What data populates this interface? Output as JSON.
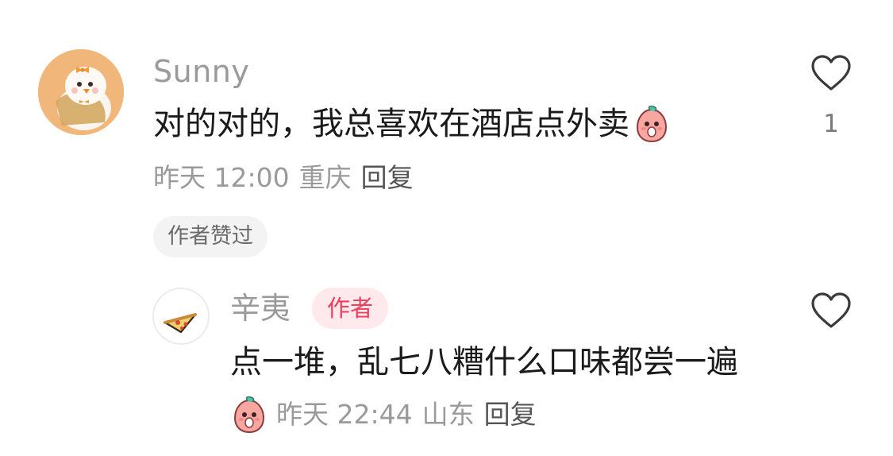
{
  "comment": {
    "username": "Sunny",
    "text": "对的对的，我总喜欢在酒店点外卖",
    "emoji_icon": "peach-emoji",
    "time": "昨天 12:00",
    "location": "重庆",
    "reply_label": "回复",
    "author_liked_chip": "作者赞过",
    "like_count": "1"
  },
  "reply": {
    "username": "辛夷",
    "author_badge": "作者",
    "text": "点一堆，乱七八糟什么口味都尝一遍",
    "emoji_icon": "peach-emoji",
    "time": "昨天 22:44",
    "location": "山东",
    "reply_label": "回复"
  },
  "colors": {
    "accent_badge_text": "#f23d5a",
    "accent_badge_bg": "#ffe9ec",
    "muted_text": "#9a9a9a",
    "main_text": "#1a1a1a"
  }
}
